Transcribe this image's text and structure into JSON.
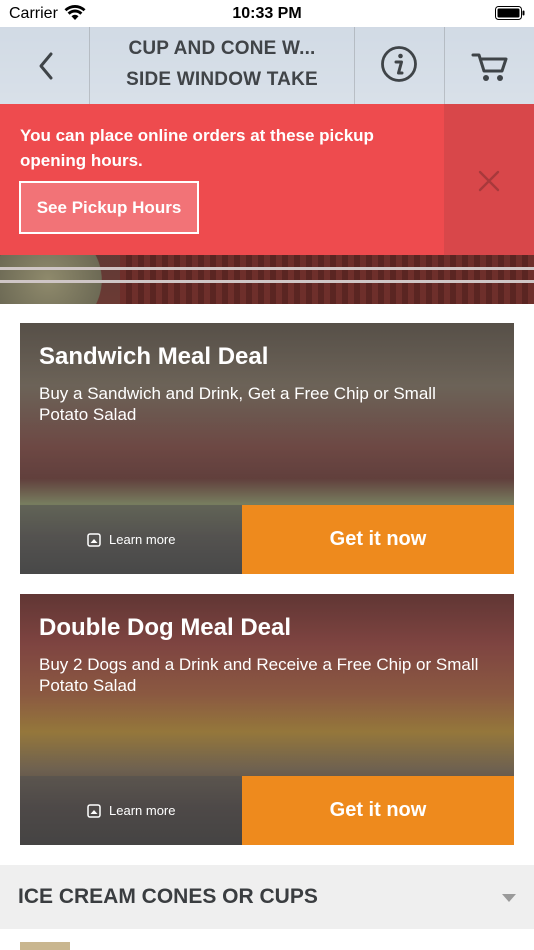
{
  "status_bar": {
    "carrier": "Carrier",
    "time": "10:33 PM",
    "icons": [
      "wifi-icon",
      "battery-icon"
    ]
  },
  "nav": {
    "title_line1": "CUP AND CONE W...",
    "title_line2": "SIDE WINDOW TAKE",
    "icons": [
      "back-chevron-icon",
      "info-icon",
      "cart-icon"
    ]
  },
  "banner": {
    "message": "You can place online orders at these pickup opening hours.",
    "button_label": "See Pickup Hours",
    "icon": "close-icon"
  },
  "deals": [
    {
      "title": "Sandwich Meal Deal",
      "description": "Buy a Sandwich and Drink, Get a Free Chip or Small Potato Salad",
      "learn_more": "Learn more",
      "cta": "Get it now"
    },
    {
      "title": "Double Dog Meal Deal",
      "description": "Buy 2 Dogs and a Drink and Receive a Free Chip or Small Potato Salad",
      "learn_more": "Learn more",
      "cta": "Get it now"
    }
  ],
  "category": {
    "label": "ICE CREAM CONES OR CUPS",
    "icon": "chevron-down-icon"
  },
  "colors": {
    "banner_red": "#ee4b4e",
    "cta_orange": "#ee8a1d",
    "category_bg": "#efefef"
  }
}
